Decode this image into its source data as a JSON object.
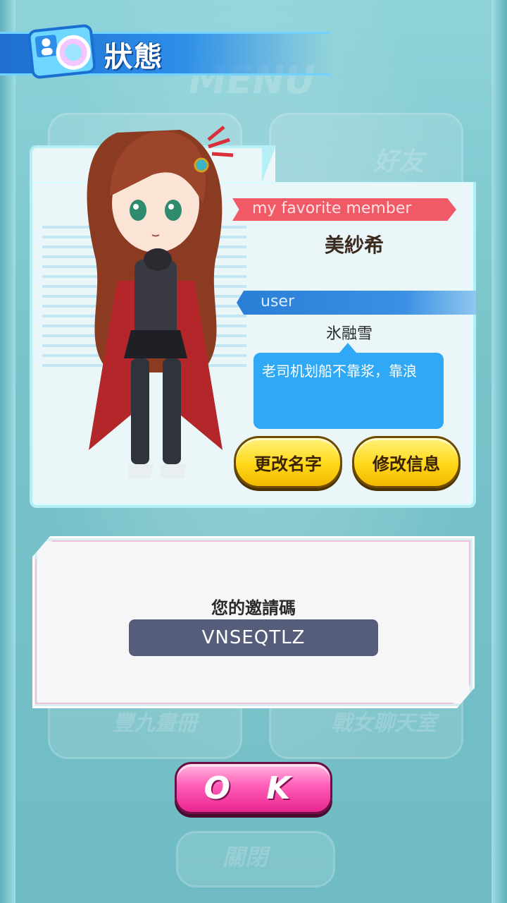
{
  "header": {
    "title": "狀態",
    "icon": "profile-card-icon"
  },
  "background": {
    "words": [
      "MENU",
      "好友",
      "豐九畫冊",
      "戰女聊天室",
      "關閉"
    ]
  },
  "profile": {
    "favorite_label": "my favorite member",
    "favorite_name": "美紗希",
    "user_label": "user",
    "user_name": "氷融雪",
    "message": "老司机划船不靠浆，靠浪",
    "rename_button": "更改名字",
    "edit_info_button": "修改信息"
  },
  "invite": {
    "label": "您的邀請碼",
    "code": "VNSEQTLZ"
  },
  "ok_button": "O K",
  "colors": {
    "header_blue": "#2d8ee8",
    "ribbon_red": "#ef5a66",
    "bubble_blue": "#2fa8f5",
    "button_yellow": "#ffd818",
    "ok_pink": "#ff5fb8"
  }
}
